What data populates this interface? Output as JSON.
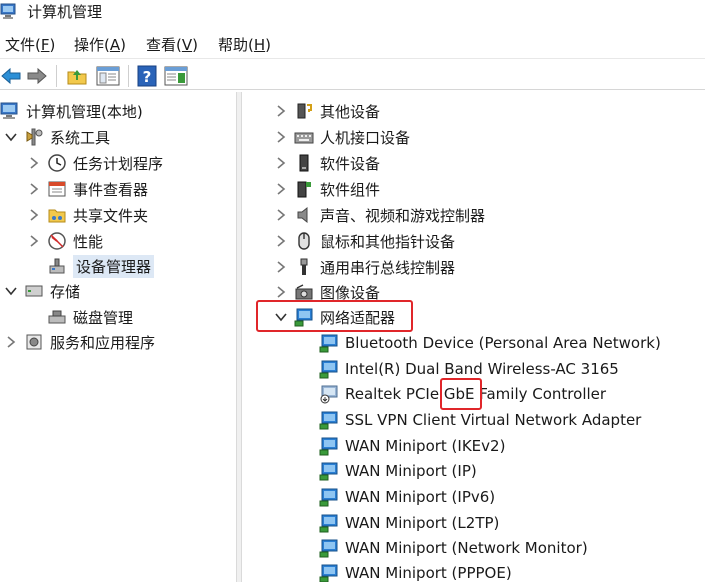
{
  "window": {
    "title": "计算机管理"
  },
  "menu": [
    {
      "label": "文件(",
      "key": "F",
      "end": ")"
    },
    {
      "label": "操作(",
      "key": "A",
      "end": ")"
    },
    {
      "label": "查看(",
      "key": "V",
      "end": ")"
    },
    {
      "label": "帮助(",
      "key": "H",
      "end": ")"
    }
  ],
  "left_tree": {
    "root": "计算机管理(本地)",
    "system_tools": "系统工具",
    "task_scheduler": "任务计划程序",
    "event_viewer": "事件查看器",
    "shared_folders": "共享文件夹",
    "performance": "性能",
    "device_manager": "设备管理器",
    "storage": "存储",
    "disk_management": "磁盘管理",
    "services_apps": "服务和应用程序"
  },
  "device_categories": [
    "其他设备",
    "人机接口设备",
    "软件设备",
    "软件组件",
    "声音、视频和游戏控制器",
    "鼠标和其他指针设备",
    "通用串行总线控制器",
    "图像设备",
    "网络适配器"
  ],
  "network_adapters": [
    "Bluetooth Device (Personal Area Network)",
    "Intel(R) Dual Band Wireless-AC 3165",
    "Realtek PCIe GbE Family Controller",
    "SSL VPN Client Virtual Network Adapter",
    "WAN Miniport (IKEv2)",
    "WAN Miniport (IP)",
    "WAN Miniport (IPv6)",
    "WAN Miniport (L2TP)",
    "WAN Miniport (Network Monitor)",
    "WAN Miniport (PPPOE)"
  ],
  "colors": {
    "highlight": "#e0262a",
    "selection": "#dde8f5",
    "accent": "#2a7fd4"
  }
}
